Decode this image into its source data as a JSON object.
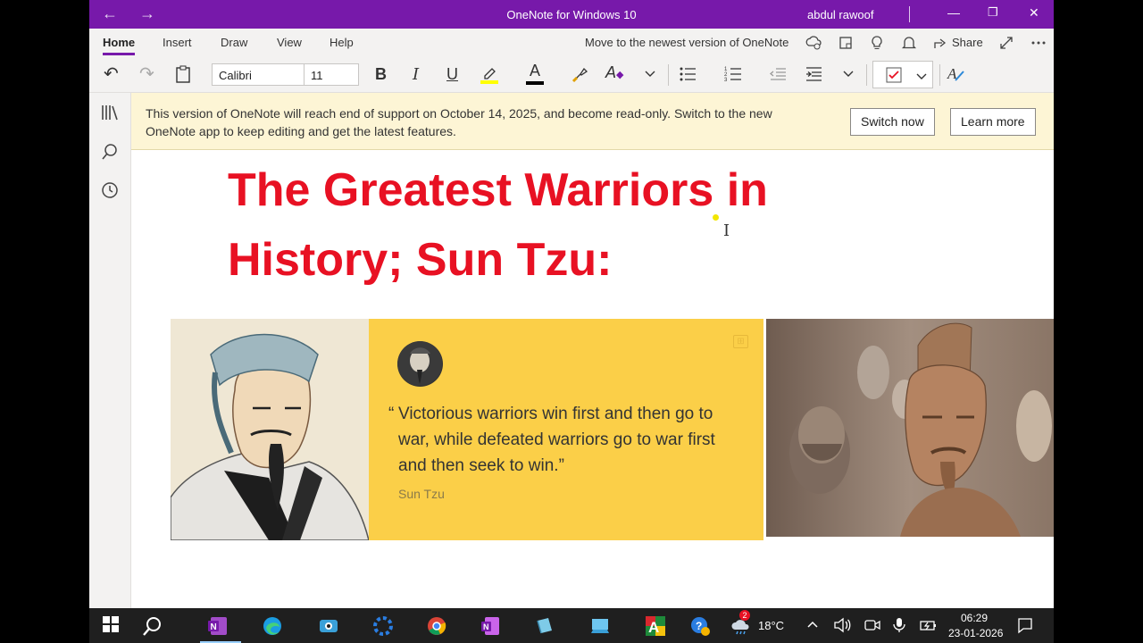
{
  "titlebar": {
    "title": "OneNote for Windows 10",
    "user": "abdul rawoof",
    "back_icon": "back-arrow-icon",
    "forward_icon": "forward-arrow-icon",
    "back_glyph": "←",
    "forward_glyph": "→",
    "minimize_glyph": "—",
    "maximize_glyph": "❐",
    "close_glyph": "✕"
  },
  "ribbon": {
    "tabs": [
      "Home",
      "Insert",
      "Draw",
      "View",
      "Help"
    ],
    "active_tab": "Home",
    "move_link": "Move to the newest version of OneNote",
    "share_label": "Share"
  },
  "toolbar": {
    "font_name": "Calibri",
    "font_size": "11",
    "undo_glyph": "↶",
    "redo_glyph": "↷",
    "bold_glyph": "B",
    "italic_glyph": "I",
    "underline_glyph": "U",
    "font_color_glyph": "A",
    "styles_glyph": "A",
    "accent": "#7719aa"
  },
  "banner": {
    "message": "This version of OneNote will reach end of support on October 14, 2025, and become read-only. Switch to the new OneNote app to keep editing and get the latest features.",
    "switch_now": "Switch now",
    "learn_more": "Learn more"
  },
  "page": {
    "heading": "The Greatest Warriors in History; Sun Tzu:",
    "heading_color": "#e81123",
    "cursor_glyph": "I"
  },
  "quote_card": {
    "open_quote": "“",
    "text": "Victorious warriors win first and then go to war, while defeated warriors go to war first and then seek to win.”",
    "author": "Sun Tzu",
    "background": "#fbcf48"
  },
  "taskbar": {
    "weather_temp": "18°C",
    "time": "06:29",
    "date": "23-01-2026",
    "badge_count": "2"
  }
}
